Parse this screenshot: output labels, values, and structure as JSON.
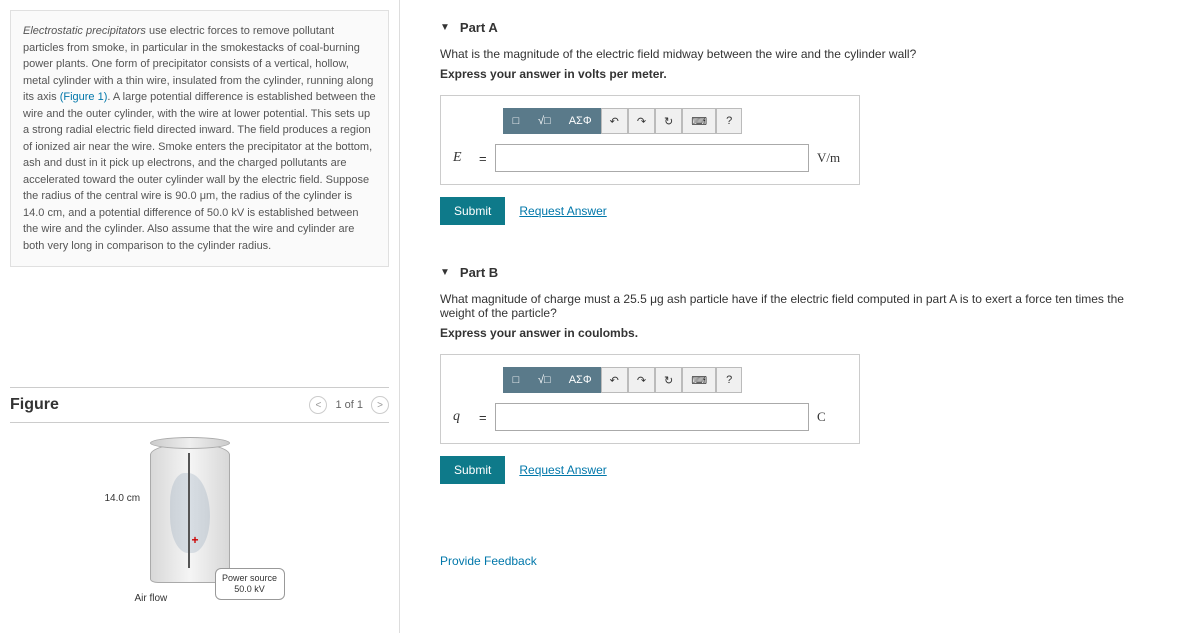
{
  "problem": {
    "text_prefix": "Electrostatic precipitators",
    "text_body": " use electric forces to remove pollutant particles from smoke, in particular in the smokestacks of coal-burning power plants. One form of precipitator consists of a vertical, hollow, metal cylinder with a thin wire, insulated from the cylinder, running along its axis ",
    "figure_ref": "(Figure 1)",
    "text_body2": ". A large potential difference is established between the wire and the outer cylinder, with the wire at lower potential. This sets up a strong radial electric field directed inward. The field produces a region of ionized air near the wire. Smoke enters the precipitator at the bottom, ash and dust in it pick up electrons, and the charged pollutants are accelerated toward the outer cylinder wall by the electric field. Suppose the radius of the central wire is 90.0 μm, the radius of the cylinder is 14.0 cm, and a potential difference of 50.0 kV is established between the wire and the cylinder. Also assume that the wire and cylinder are both very long in comparison to the cylinder radius."
  },
  "figure": {
    "title": "Figure",
    "pager": "1 of 1",
    "dim": "14.0 cm",
    "power_line1": "Power source",
    "power_line2": "50.0 kV",
    "airflow": "Air flow"
  },
  "partA": {
    "title": "Part A",
    "question": "What is the magnitude of the electric field midway between the wire and the cylinder wall?",
    "instruction": "Express your answer in volts per meter.",
    "var": "E",
    "unit": "V/m",
    "submit": "Submit",
    "request": "Request Answer"
  },
  "partB": {
    "title": "Part B",
    "question": "What magnitude of charge must a 25.5 μg ash particle have if the electric field computed in part A is to exert a force ten times the weight of the particle?",
    "instruction": "Express your answer in coulombs.",
    "var": "q",
    "unit": "C",
    "submit": "Submit",
    "request": "Request Answer"
  },
  "toolbar": {
    "templates": "□",
    "sqrt": "√□",
    "greek": "ΑΣΦ",
    "undo": "↶",
    "redo": "↷",
    "reset": "↻",
    "keyboard": "⌨",
    "help": "?"
  },
  "feedback": "Provide Feedback"
}
